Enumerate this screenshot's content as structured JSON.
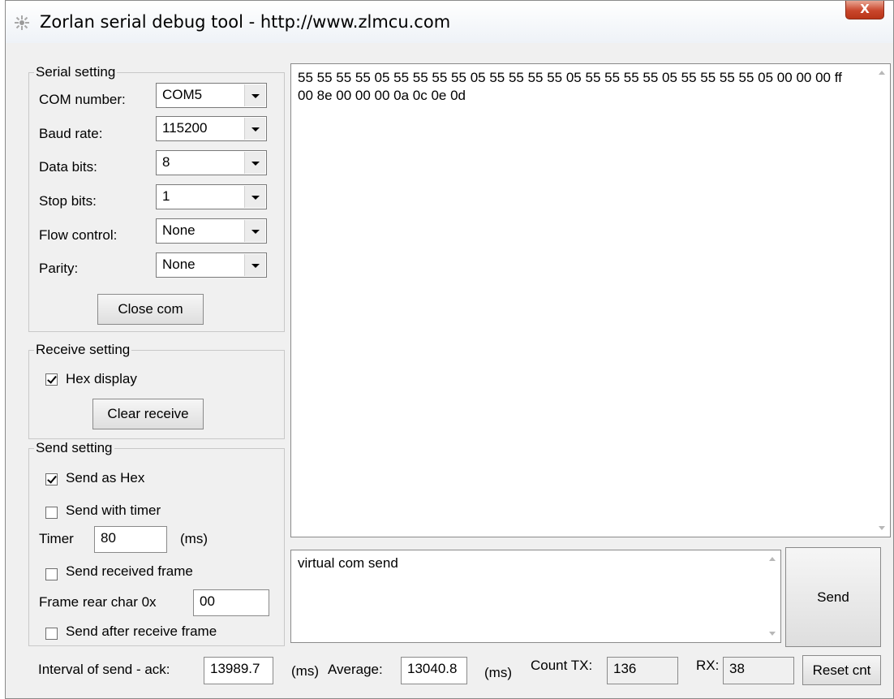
{
  "window": {
    "title": "Zorlan serial debug tool - http://www.zlmcu.com",
    "close_label": "X"
  },
  "serial_setting": {
    "label": "Serial setting",
    "com_label": "COM number:",
    "com_value": "COM5",
    "baud_label": "Baud rate:",
    "baud_value": "115200",
    "data_bits_label": "Data bits:",
    "data_bits_value": "8",
    "stop_bits_label": "Stop bits:",
    "stop_bits_value": "1",
    "flow_label": "Flow control:",
    "flow_value": "None",
    "parity_label": "Parity:",
    "parity_value": "None",
    "close_com_label": "Close com"
  },
  "receive_setting": {
    "label": "Receive setting",
    "hex_display_label": "Hex display",
    "hex_display_checked": true,
    "clear_receive_label": "Clear receive"
  },
  "send_setting": {
    "label": "Send setting",
    "send_as_hex_label": "Send as Hex",
    "send_as_hex_checked": true,
    "send_with_timer_label": "Send with timer",
    "send_with_timer_checked": false,
    "timer_label": "Timer",
    "timer_value": "80",
    "timer_unit": "(ms)",
    "send_received_frame_label": "Send received frame",
    "send_received_frame_checked": false,
    "frame_rear_label": "Frame rear char 0x",
    "frame_rear_value": "00",
    "send_after_receive_label": "Send after receive frame",
    "send_after_receive_checked": false
  },
  "receive_area": {
    "text": "55 55 55 55 05 55 55 55 55 05 55 55 55 55 05 55 55 55 55 05 55 55 55 55 05 00 00 00 ff 00 8e 00 00 00 0a 0c 0e 0d"
  },
  "send_area": {
    "text": "virtual com send",
    "send_button_label": "Send"
  },
  "status_bar": {
    "interval_label": "Interval of send - ack:",
    "interval_value": "13989.7",
    "ms_label_1": "(ms)",
    "average_label": "Average:",
    "average_value": "13040.8",
    "ms_label_2": "(ms)",
    "count_tx_label": "Count TX:",
    "count_tx_value": "136",
    "rx_label": "RX:",
    "rx_value": "38",
    "reset_label": "Reset cnt"
  }
}
